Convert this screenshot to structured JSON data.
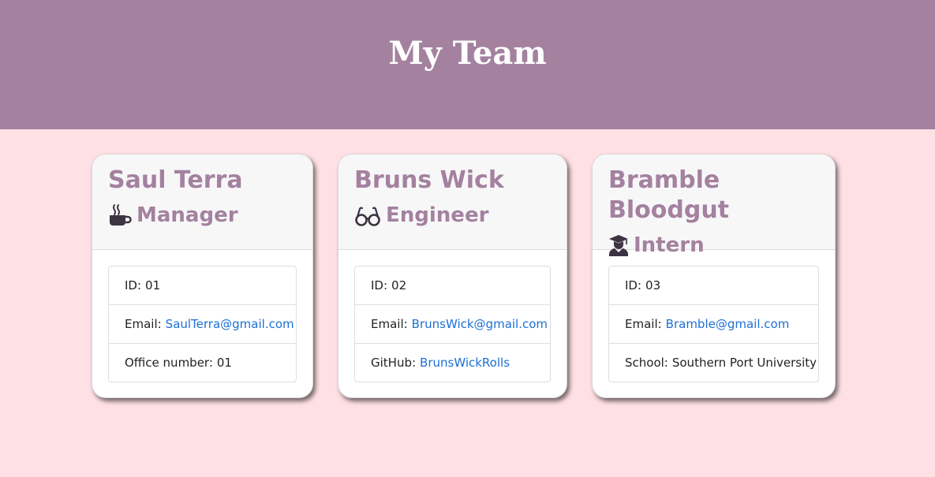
{
  "header": {
    "title": "My Team"
  },
  "colors": {
    "header_bg": "#a3819f",
    "page_bg": "#ffe0e5",
    "accent": "#a3819f",
    "link": "#1c6fd6"
  },
  "cards": [
    {
      "name": "Saul Terra",
      "role": "Manager",
      "icon": "coffee-mug-icon",
      "id_label": "ID:",
      "id_value": "01",
      "email_label": "Email:",
      "email_value": "SaulTerra@gmail.com",
      "extra_label": "Office number:",
      "extra_value": "01"
    },
    {
      "name": "Bruns Wick",
      "role": "Engineer",
      "icon": "glasses-icon",
      "id_label": "ID:",
      "id_value": "02",
      "email_label": "Email:",
      "email_value": "BrunsWick@gmail.com",
      "extra_label": "GitHub:",
      "extra_value": "BrunsWickRolls"
    },
    {
      "name": "Bramble Bloodgut",
      "role": "Intern",
      "icon": "graduate-icon",
      "id_label": "ID:",
      "id_value": "03",
      "email_label": "Email:",
      "email_value": "Bramble@gmail.com",
      "extra_label": "School:",
      "extra_value": "Southern Port University"
    }
  ]
}
